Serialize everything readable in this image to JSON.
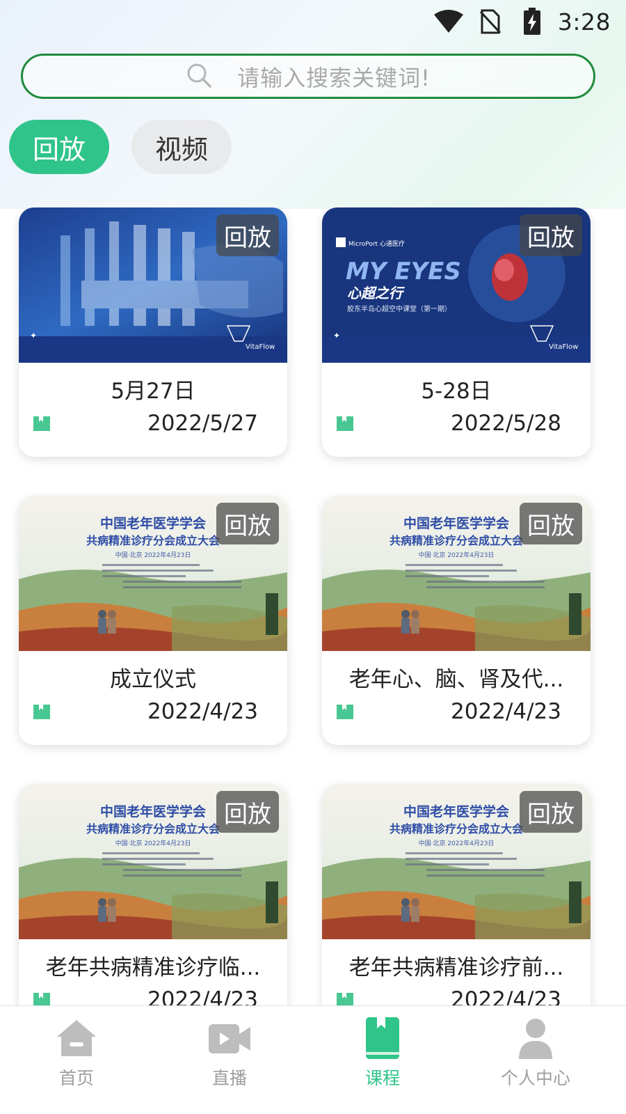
{
  "status_bar": {
    "time": "3:28",
    "icons": [
      "wifi-icon",
      "no-sim-icon",
      "battery-charging-icon"
    ]
  },
  "search": {
    "placeholder": "请输入搜索关键词!",
    "icon": "search-icon"
  },
  "filter_tabs": [
    {
      "label": "回放",
      "active": true
    },
    {
      "label": "视频",
      "active": false
    }
  ],
  "cards": [
    {
      "badge": "回放",
      "title": "5月27日",
      "date": "2022/5/27",
      "thumbnail": "vitaflow-blue-banner"
    },
    {
      "badge": "回放",
      "title": "5-28日",
      "date": "2022/5/28",
      "thumbnail": "my-eyes-heart-banner",
      "thumb_texts": [
        "MicroPort 心通医疗",
        "MY EYES",
        "心超之行",
        "胶东半岛心超空中课堂（第一期）",
        "VitaFlow"
      ]
    },
    {
      "badge": "回放",
      "title": "成立仪式",
      "date": "2022/4/23",
      "thumbnail": "geriatric-society-poster",
      "thumb_texts": [
        "中国老年医学学会",
        "共病精准诊疗分会成立大会",
        "中国·北京 2022年4月23日"
      ]
    },
    {
      "badge": "回放",
      "title": "老年心、脑、肾及代...",
      "date": "2022/4/23",
      "thumbnail": "geriatric-society-poster",
      "thumb_texts": [
        "中国老年医学学会",
        "共病精准诊疗分会成立大会",
        "中国·北京 2022年4月23日"
      ]
    },
    {
      "badge": "回放",
      "title": "老年共病精准诊疗临...",
      "date": "2022/4/23",
      "thumbnail": "geriatric-society-poster",
      "thumb_texts": [
        "中国老年医学学会",
        "共病精准诊疗分会成立大会",
        "中国·北京 2022年4月23日"
      ]
    },
    {
      "badge": "回放",
      "title": "老年共病精准诊疗前...",
      "date": "2022/4/23",
      "thumbnail": "geriatric-society-poster",
      "thumb_texts": [
        "中国老年医学学会",
        "共病精准诊疗分会成立大会",
        "中国·北京 2022年4月23日"
      ]
    }
  ],
  "bottom_nav": [
    {
      "label": "首页",
      "icon": "home-icon",
      "active": false
    },
    {
      "label": "直播",
      "icon": "live-video-icon",
      "active": false
    },
    {
      "label": "课程",
      "icon": "course-book-icon",
      "active": true
    },
    {
      "label": "个人中心",
      "icon": "user-icon",
      "active": false
    }
  ],
  "colors": {
    "accent": "#2fc48a",
    "search_border": "#1f8a3a",
    "badge_bg": "#464646",
    "inactive_nav": "#bdbdbd"
  }
}
